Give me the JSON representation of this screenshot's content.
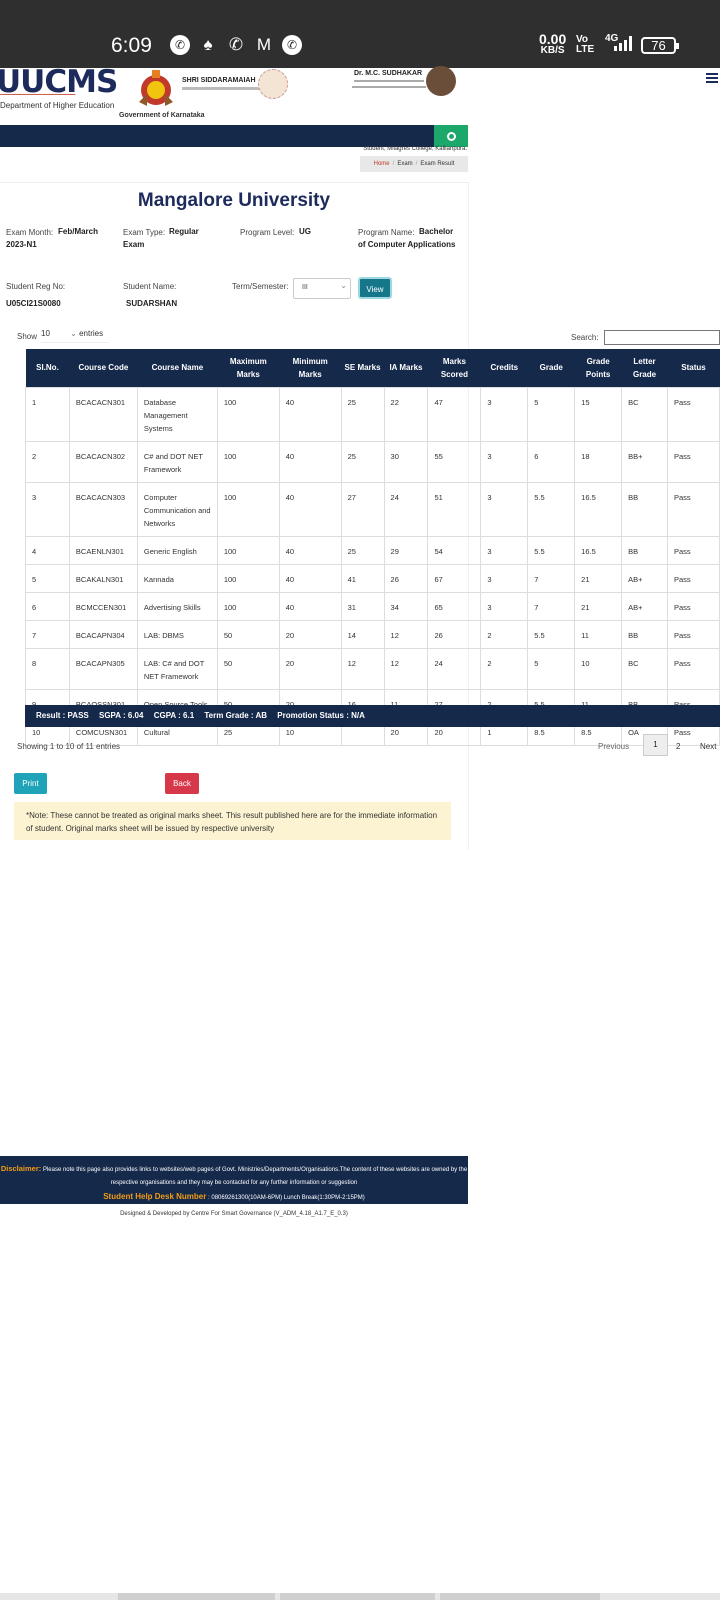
{
  "status_bar": {
    "time": "6:09",
    "net_speed": "0.00",
    "net_unit": "KB/S",
    "volte_top": "Vo",
    "volte_bottom": "LTE",
    "network": "4G",
    "battery": "76"
  },
  "header": {
    "logo": "UUCMS",
    "logo_dept": "Department of Higher Education",
    "gov_label": "Government of Karnataka",
    "cm_name": "SHRI SIDDARAMAIAH",
    "minister_name": "Dr. M.C. SUDHAKAR"
  },
  "nav": {
    "student_line": "Student, Milagres College, Kallianpura.",
    "breadcrumb": [
      "Home",
      "Exam",
      "Exam Result"
    ]
  },
  "exam": {
    "university": "Mangalore University",
    "exam_month_label": "Exam Month:",
    "exam_month_value": "Feb/March 2023-N1",
    "exam_type_label": "Exam Type:",
    "exam_type_value": "Regular Exam",
    "program_level_label": "Program Level:",
    "program_level_value": "UG",
    "program_name_label": "Program Name:",
    "program_name_value": "Bachelor of Computer Applications",
    "reg_no_label": "Student Reg No:",
    "reg_no_value": "U05CI21S0080",
    "student_name_label": "Student Name:",
    "student_name_value": "SUDARSHAN",
    "term_label": "Term/Semester:",
    "term_value": "III",
    "view_button": "View"
  },
  "table": {
    "show_label": "Show",
    "show_value": "10",
    "entries_label": "entries",
    "search_label": "Search:",
    "headers": [
      "Sl.No.",
      "Course Code",
      "Course Name",
      "Maximum Marks",
      "Minimum Marks",
      "SE Marks",
      "IA Marks",
      "Marks Scored",
      "Credits",
      "Grade",
      "Grade Points",
      "Letter Grade",
      "Status"
    ],
    "rows": [
      [
        "1",
        "BCACACN301",
        "Database Management Systems",
        "100",
        "40",
        "25",
        "22",
        "47",
        "3",
        "5",
        "15",
        "BC",
        "Pass"
      ],
      [
        "2",
        "BCACACN302",
        "C# and DOT NET Framework",
        "100",
        "40",
        "25",
        "30",
        "55",
        "3",
        "6",
        "18",
        "BB+",
        "Pass"
      ],
      [
        "3",
        "BCACACN303",
        "Computer Communication and Networks",
        "100",
        "40",
        "27",
        "24",
        "51",
        "3",
        "5.5",
        "16.5",
        "BB",
        "Pass"
      ],
      [
        "4",
        "BCAENLN301",
        "Generic English",
        "100",
        "40",
        "25",
        "29",
        "54",
        "3",
        "5.5",
        "16.5",
        "BB",
        "Pass"
      ],
      [
        "5",
        "BCAKALN301",
        "Kannada",
        "100",
        "40",
        "41",
        "26",
        "67",
        "3",
        "7",
        "21",
        "AB+",
        "Pass"
      ],
      [
        "6",
        "BCMCCEN301",
        "Advertising Skills",
        "100",
        "40",
        "31",
        "34",
        "65",
        "3",
        "7",
        "21",
        "AB+",
        "Pass"
      ],
      [
        "7",
        "BCACAPN304",
        "LAB: DBMS",
        "50",
        "20",
        "14",
        "12",
        "26",
        "2",
        "5.5",
        "11",
        "BB",
        "Pass"
      ],
      [
        "8",
        "BCACAPN305",
        "LAB: C# and DOT NET Framework",
        "50",
        "20",
        "12",
        "12",
        "24",
        "2",
        "5",
        "10",
        "BC",
        "Pass"
      ],
      [
        "9",
        "BCAOSSN301",
        "Open Source Tools",
        "50",
        "20",
        "16",
        "11",
        "27",
        "2",
        "5.5",
        "11",
        "BB",
        "Pass"
      ],
      [
        "10",
        "COMCUSN301",
        "Cultural",
        "25",
        "10",
        "",
        "20",
        "20",
        "1",
        "8.5",
        "8.5",
        "OA",
        "Pass"
      ]
    ],
    "result": "Result : PASS",
    "sgpa": "SGPA : 6.04",
    "cgpa": "CGPA : 6.1",
    "term_grade": "Term Grade : AB",
    "promotion": "Promotion Status : N/A",
    "showing": "Showing 1 to 10 of 11 entries",
    "previous": "Previous",
    "page1": "1",
    "page2": "2",
    "next": "Next"
  },
  "actions": {
    "print": "Print",
    "back": "Back",
    "note": "*Note: These cannot be treated as original marks sheet. This result published here are for the immediate information of student. Original marks sheet will be issued by respective university"
  },
  "footer": {
    "disclaimer_label": "Disclaimer:",
    "disclaimer_text": "Please note this page also provides links to websites/web pages of Govt. Ministries/Departments/Organisations.The content of these websites are owned by the respective organisations and they may be contacted for any further information or suggestion",
    "help_label": "Student Help Desk Number",
    "help_value": ": 08069261300(10AM-6PM) Lunch Break(1:30PM-2:15PM)",
    "designed": "Designed & Developed by Centre For Smart Governance (V_ADM_4.18_A1.7_E_0.3)"
  }
}
